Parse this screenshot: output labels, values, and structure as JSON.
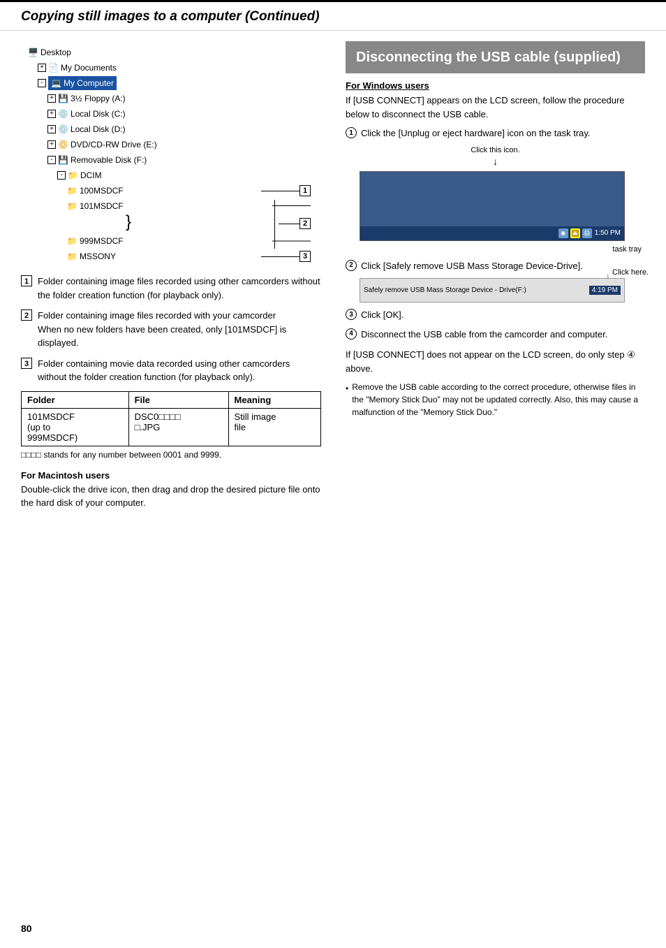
{
  "header": {
    "title": "Copying still images to a computer (Continued)"
  },
  "left": {
    "tree": {
      "items": [
        {
          "indent": 0,
          "icon": "🖥️",
          "label": "Desktop",
          "type": "root"
        },
        {
          "indent": 1,
          "expand": "+",
          "icon": "📄",
          "label": "My Documents",
          "type": "item"
        },
        {
          "indent": 1,
          "expand": "-",
          "icon": "💻",
          "label": "My Computer",
          "type": "item",
          "highlight": true
        },
        {
          "indent": 2,
          "expand": "+",
          "icon": "💾",
          "label": "3½ Floppy (A:)",
          "type": "item"
        },
        {
          "indent": 2,
          "expand": "+",
          "icon": "💿",
          "label": "Local Disk (C:)",
          "type": "item"
        },
        {
          "indent": 2,
          "expand": "+",
          "icon": "💿",
          "label": "Local Disk (D:)",
          "type": "item"
        },
        {
          "indent": 2,
          "expand": "+",
          "icon": "📀",
          "label": "DVD/CD-RW Drive (E:)",
          "type": "item"
        },
        {
          "indent": 2,
          "expand": "-",
          "icon": "💾",
          "label": "Removable Disk (F:)",
          "type": "item"
        },
        {
          "indent": 3,
          "expand": "-",
          "icon": "📁",
          "label": "DCIM",
          "type": "item"
        },
        {
          "indent": 4,
          "expand": "",
          "icon": "📁",
          "label": "100MSDCF",
          "type": "item",
          "badge": "1"
        },
        {
          "indent": 4,
          "expand": "",
          "icon": "📁",
          "label": "101MSDCF",
          "type": "item",
          "badge": "2"
        },
        {
          "indent": 4,
          "expand": "",
          "icon": "",
          "label": "}",
          "type": "brace"
        },
        {
          "indent": 4,
          "expand": "",
          "icon": "📁",
          "label": "999MSDCF",
          "type": "item"
        },
        {
          "indent": 4,
          "expand": "",
          "icon": "📁",
          "label": "MSSONY",
          "type": "item",
          "badge": "3"
        }
      ]
    },
    "descriptions": [
      {
        "num": "1",
        "text": "Folder containing image files recorded using other camcorders without the folder creation function (for playback only)."
      },
      {
        "num": "2",
        "text": "Folder containing image files recorded with your camcorder\nWhen no new folders have been created, only [101MSDCF] is displayed."
      },
      {
        "num": "3",
        "text": "Folder containing movie data recorded using other camcorders without the folder creation function (for playback only)."
      }
    ],
    "table": {
      "headers": [
        "Folder",
        "File",
        "Meaning"
      ],
      "rows": [
        [
          "101MSDCF\n(up to\n999MSDCF)",
          "DSC0□□□□\n□.JPG",
          "Still image\nfile"
        ]
      ]
    },
    "table_note": "□□□□ stands for any number between 0001 and 9999.",
    "mac_section": {
      "heading": "For Macintosh users",
      "text": "Double-click the drive icon, then drag and drop the desired picture file onto the hard disk of your computer."
    }
  },
  "right": {
    "section_title": "Disconnecting the USB cable (supplied)",
    "windows": {
      "heading": "For Windows users",
      "intro": "If [USB CONNECT] appears on the LCD screen, follow the procedure below to disconnect the USB cable.",
      "steps": [
        {
          "num": "1",
          "text": "Click the [Unplug or eject hardware] icon on the task tray."
        },
        {
          "num": "2",
          "text": "Click [Safely remove USB Mass Storage Device-Drive]."
        },
        {
          "num": "3",
          "text": "Click [OK]."
        },
        {
          "num": "4",
          "text": "Disconnect the USB cable from the camcorder and computer."
        }
      ],
      "screenshot1": {
        "label_top": "Click this icon.",
        "time": "1:50 PM",
        "label_bottom": "task tray"
      },
      "screenshot2": {
        "text": "Safely remove USB Mass Storage Device - Drive(F:)",
        "time": "4:19 PM",
        "label": "Click here."
      }
    },
    "lcd_note": "If [USB CONNECT] does not appear on the LCD screen, do only step ④ above.",
    "bullet_note": "Remove the USB cable according to the correct procedure, otherwise files in the \"Memory Stick Duo\" may not be updated correctly. Also, this may cause a malfunction of the \"Memory Stick Duo.\""
  },
  "page_number": "80"
}
